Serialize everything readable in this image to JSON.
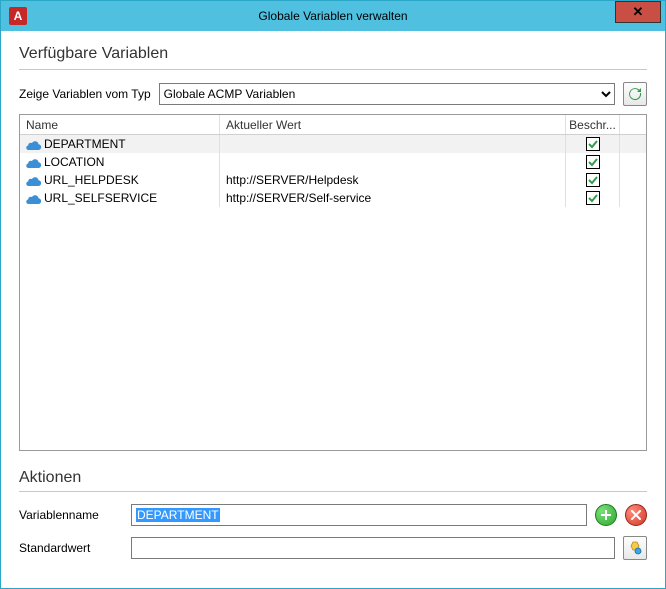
{
  "window": {
    "title": "Globale Variablen verwalten",
    "app_icon_letter": "A"
  },
  "section_available": "Verfügbare Variablen",
  "filter": {
    "label": "Zeige Variablen vom Typ",
    "selected": "Globale ACMP Variablen"
  },
  "table": {
    "columns": {
      "name": "Name",
      "value": "Aktueller Wert",
      "desc": "Beschr..."
    },
    "rows": [
      {
        "name": "DEPARTMENT",
        "value": "",
        "checked": true,
        "selected": true
      },
      {
        "name": "LOCATION",
        "value": "",
        "checked": true,
        "selected": false
      },
      {
        "name": "URL_HELPDESK",
        "value": "http://SERVER/Helpdesk",
        "checked": true,
        "selected": false
      },
      {
        "name": "URL_SELFSERVICE",
        "value": "http://SERVER/Self-service",
        "checked": true,
        "selected": false
      }
    ]
  },
  "section_actions": "Aktionen",
  "form": {
    "name_label": "Variablenname",
    "name_value": "DEPARTMENT",
    "default_label": "Standardwert",
    "default_value": ""
  }
}
